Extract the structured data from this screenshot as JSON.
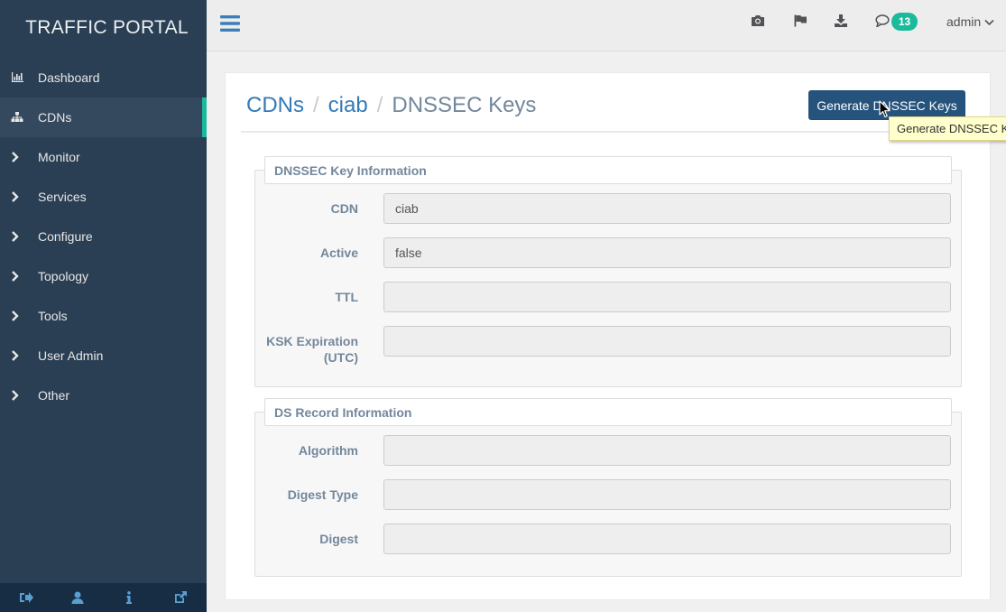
{
  "app": {
    "brand": "TRAFFIC PORTAL"
  },
  "sidebar": {
    "items": [
      {
        "label": "Dashboard",
        "icon": "bar-chart-icon",
        "active": false
      },
      {
        "label": "CDNs",
        "icon": "sitemap-icon",
        "active": true
      },
      {
        "label": "Monitor",
        "icon": "chevron-right-icon",
        "active": false
      },
      {
        "label": "Services",
        "icon": "chevron-right-icon",
        "active": false
      },
      {
        "label": "Configure",
        "icon": "chevron-right-icon",
        "active": false
      },
      {
        "label": "Topology",
        "icon": "chevron-right-icon",
        "active": false
      },
      {
        "label": "Tools",
        "icon": "chevron-right-icon",
        "active": false
      },
      {
        "label": "User Admin",
        "icon": "chevron-right-icon",
        "active": false
      },
      {
        "label": "Other",
        "icon": "chevron-right-icon",
        "active": false
      }
    ],
    "footer_icons": [
      "logout-icon",
      "user-icon",
      "info-icon",
      "external-link-icon"
    ]
  },
  "topnav": {
    "icons": [
      "camera-icon",
      "flag-icon",
      "download-icon",
      "comment-icon"
    ],
    "notification_count": "13",
    "user": "admin"
  },
  "breadcrumb": {
    "items": [
      "CDNs",
      "ciab"
    ],
    "current": "DNSSEC Keys",
    "separator": "/"
  },
  "actions": {
    "generate_label": "Generate DNSSEC Keys",
    "tooltip": "Generate DNSSEC Keys"
  },
  "dnssec_info": {
    "legend": "DNSSEC Key Information",
    "fields": [
      {
        "label": "CDN",
        "value": "ciab"
      },
      {
        "label": "Active",
        "value": "false"
      },
      {
        "label": "TTL",
        "value": ""
      },
      {
        "label": "KSK Expiration (UTC)",
        "value": ""
      }
    ]
  },
  "ds_record": {
    "legend": "DS Record Information",
    "fields": [
      {
        "label": "Algorithm",
        "value": ""
      },
      {
        "label": "Digest Type",
        "value": ""
      },
      {
        "label": "Digest",
        "value": ""
      }
    ]
  },
  "colors": {
    "sidebar_bg": "#2a3f54",
    "accent": "#1abb9c",
    "primary_button": "#26537c",
    "link": "#337ab7"
  }
}
